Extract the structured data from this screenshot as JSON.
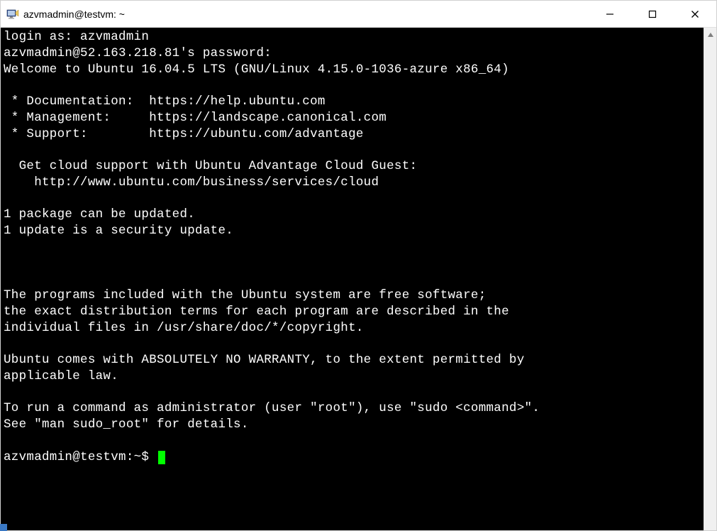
{
  "window": {
    "title": "azvmadmin@testvm: ~"
  },
  "terminal": {
    "lines": [
      "login as: azvmadmin",
      "azvmadmin@52.163.218.81's password:",
      "Welcome to Ubuntu 16.04.5 LTS (GNU/Linux 4.15.0-1036-azure x86_64)",
      "",
      " * Documentation:  https://help.ubuntu.com",
      " * Management:     https://landscape.canonical.com",
      " * Support:        https://ubuntu.com/advantage",
      "",
      "  Get cloud support with Ubuntu Advantage Cloud Guest:",
      "    http://www.ubuntu.com/business/services/cloud",
      "",
      "1 package can be updated.",
      "1 update is a security update.",
      "",
      "",
      "",
      "The programs included with the Ubuntu system are free software;",
      "the exact distribution terms for each program are described in the",
      "individual files in /usr/share/doc/*/copyright.",
      "",
      "Ubuntu comes with ABSOLUTELY NO WARRANTY, to the extent permitted by",
      "applicable law.",
      "",
      "To run a command as administrator (user \"root\"), use \"sudo <command>\".",
      "See \"man sudo_root\" for details.",
      ""
    ],
    "prompt": "azvmadmin@testvm:~$ "
  }
}
